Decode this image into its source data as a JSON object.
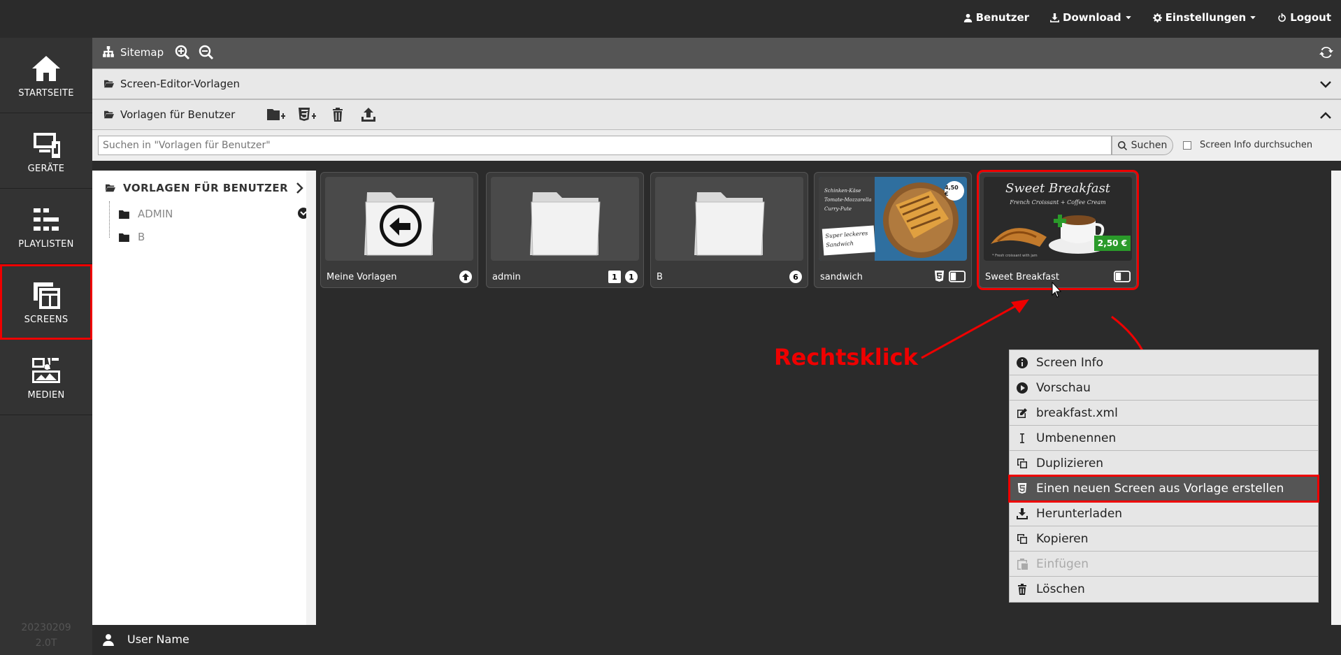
{
  "topnav": {
    "user": "Benutzer",
    "download": "Download",
    "settings": "Einstellungen",
    "logout": "Logout"
  },
  "sidebar": {
    "items": [
      {
        "label": "STARTSEITE",
        "icon": "home-icon"
      },
      {
        "label": "GERÄTE",
        "icon": "devices-icon"
      },
      {
        "label": "PLAYLISTEN",
        "icon": "playlist-icon"
      },
      {
        "label": "SCREENS",
        "icon": "screens-icon"
      },
      {
        "label": "MEDIEN",
        "icon": "media-icon"
      }
    ],
    "active": "SCREENS",
    "version_line1": "20230209",
    "version_line2": "2.0T"
  },
  "toolbar": {
    "sitemap": "Sitemap"
  },
  "accordions": {
    "screen_editor": "Screen-Editor-Vorlagen",
    "user_templates": "Vorlagen für Benutzer"
  },
  "search": {
    "placeholder": "Suchen in \"Vorlagen für Benutzer\"",
    "button": "Suchen",
    "checkbox_label": "Screen Info durchsuchen"
  },
  "tree": {
    "header": "VORLAGEN FÜR BENUTZER",
    "nodes": [
      "ADMIN",
      "B"
    ]
  },
  "cards": [
    {
      "name": "Meine Vorlagen",
      "type": "back-folder"
    },
    {
      "name": "admin",
      "type": "folder",
      "badge_folder": "1",
      "badge_count": "1"
    },
    {
      "name": "B",
      "type": "folder",
      "badge_count": "6"
    },
    {
      "name": "sandwich",
      "type": "screen",
      "thumb_text1": "Schinken-Käse",
      "thumb_text2": "Tomate-Mozzarella",
      "thumb_text3": "Curry-Pute",
      "thumb_text4": "Super leckeres",
      "thumb_text5": "Sandwich",
      "price": "4,50 €"
    },
    {
      "name": "Sweet Breakfast",
      "type": "screen",
      "thumb_title": "Sweet Breakfast",
      "thumb_sub": "French Croissant + Coffee Cream",
      "price": "2,50 €",
      "thumb_small": "* Fresh croissant with jam"
    }
  ],
  "annotation": "Rechtsklick",
  "context_menu": [
    {
      "label": "Screen Info",
      "icon": "info-icon"
    },
    {
      "label": "Vorschau",
      "icon": "play-icon"
    },
    {
      "label": "breakfast.xml",
      "icon": "edit-icon"
    },
    {
      "label": "Umbenennen",
      "icon": "text-cursor-icon"
    },
    {
      "label": "Duplizieren",
      "icon": "duplicate-icon"
    },
    {
      "label": "Einen neuen Screen aus Vorlage erstellen",
      "icon": "html5-icon",
      "highlighted": true
    },
    {
      "label": "Herunterladen",
      "icon": "download-icon"
    },
    {
      "label": "Kopieren",
      "icon": "copy-icon"
    },
    {
      "label": "Einfügen",
      "icon": "paste-icon",
      "disabled": true
    },
    {
      "label": "Löschen",
      "icon": "trash-icon"
    }
  ],
  "footer": {
    "username": "User Name"
  },
  "colors": {
    "accent_red": "#e00000",
    "dark_bg": "#2b2b2b",
    "toolbar": "#555555"
  }
}
